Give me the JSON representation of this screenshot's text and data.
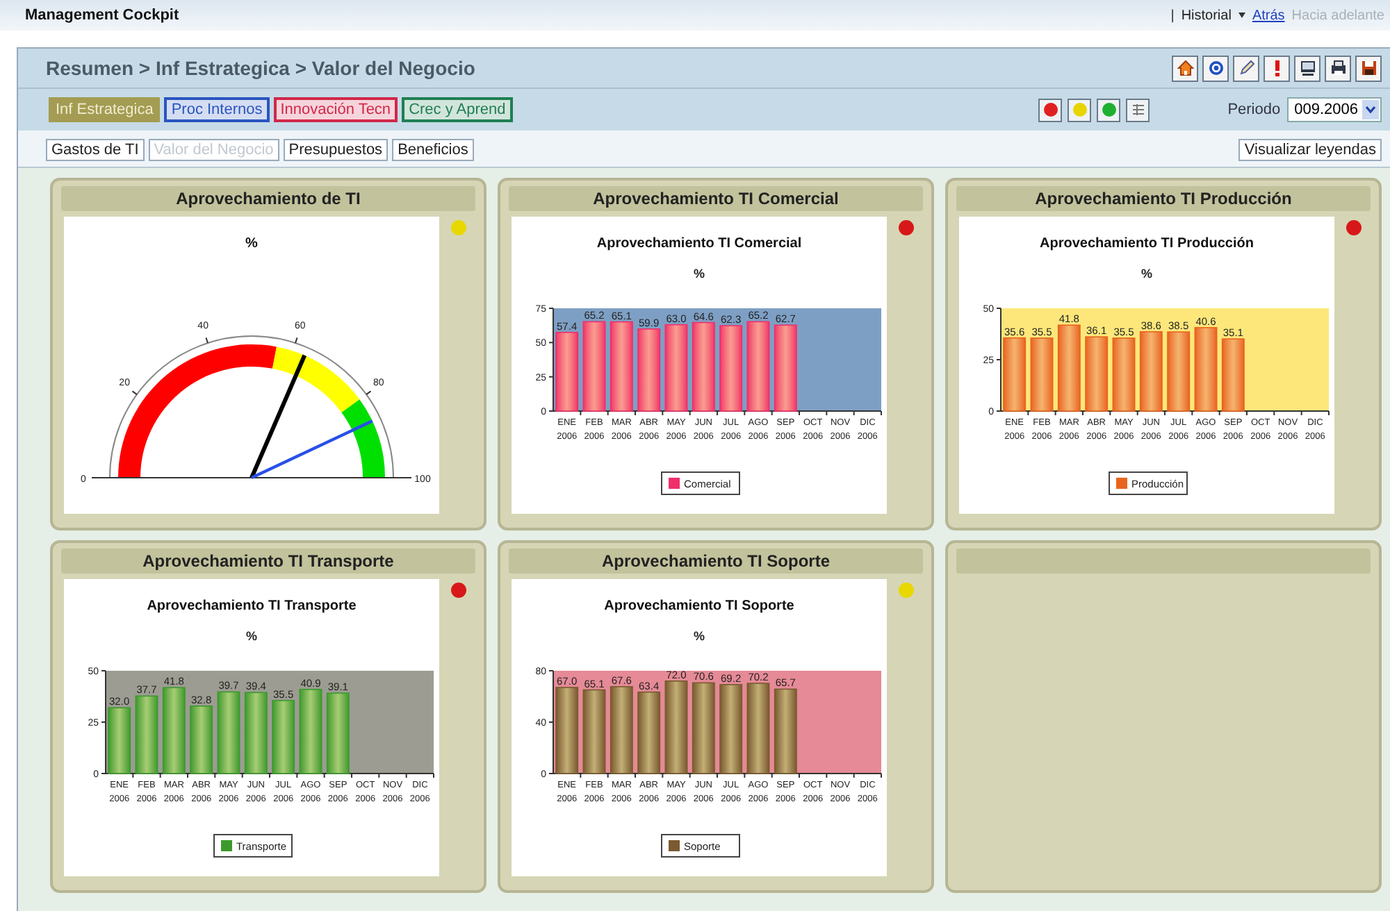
{
  "top_bar": {
    "title": "Management Cockpit",
    "separator": "|",
    "links": [
      {
        "label": "Historial",
        "kind": "menu"
      },
      {
        "label": "Atrás",
        "kind": "link"
      },
      {
        "label": "Hacia adelante",
        "kind": "disabled"
      }
    ]
  },
  "header": {
    "breadcrumb": "Resumen > Inf Estrategica > Valor del Negocio"
  },
  "tabs": [
    {
      "label": "Inf Estrategica",
      "selected": true,
      "color": "#a39c52"
    },
    {
      "label": "Proc Internos",
      "selected": false,
      "color": "#2a55c0"
    },
    {
      "label": "Innovación Tecn",
      "selected": false,
      "color": "#d0284a"
    },
    {
      "label": "Crec y Aprend",
      "selected": false,
      "color": "#1f7f52"
    }
  ],
  "status_filters": [
    {
      "color": "#e02020"
    },
    {
      "color": "#e8d400"
    },
    {
      "color": "#20b030"
    }
  ],
  "period": {
    "label": "Periodo",
    "value": "009.2006"
  },
  "subtabs": [
    {
      "label": "Gastos de TI",
      "selected": false
    },
    {
      "label": "Valor del Negocio",
      "selected": true
    },
    {
      "label": "Presupuestos",
      "selected": false
    },
    {
      "label": "Beneficios",
      "selected": false
    }
  ],
  "legend_button": "Visualizar leyendas",
  "panels": [
    {
      "kind": "gauge",
      "title": "Aprovechamiento de TI",
      "color": "#e8d800",
      "gauge": {
        "title": "%",
        "ticks": [
          "0",
          "20",
          "40",
          "60",
          "80",
          "100"
        ],
        "bands": [
          {
            "color": "#ff0000"
          },
          {
            "color": "#ffff00"
          },
          {
            "color": "#00e000"
          }
        ],
        "needles": [
          {
            "kind": "value"
          },
          {
            "kind": "target"
          }
        ]
      }
    },
    {
      "kind": "bars",
      "title": "Aprovechamiento TI Comercial",
      "color": "#d81818",
      "plot": {
        "color": "#7e9fc4"
      },
      "chart_data": {
        "type": "bar",
        "title": "Aprovechamiento TI Comercial",
        "ylabel": "%",
        "categories": [
          "ENE 2006",
          "FEB 2006",
          "MAR 2006",
          "ABR 2006",
          "MAY 2006",
          "JUN 2006",
          "JUL 2006",
          "AGO 2006",
          "SEP 2006",
          "OCT 2006",
          "NOV 2006",
          "DIC 2006"
        ],
        "series": [
          {
            "name": "Comercial",
            "color": "#f0306a",
            "values": [
              57.4,
              65.2,
              65.1,
              59.9,
              63.0,
              64.6,
              62.3,
              65.2,
              62.7,
              null,
              null,
              null
            ]
          }
        ],
        "ylim": [
          0,
          75
        ],
        "yticks": [
          0,
          25,
          50,
          75
        ],
        "value_labels": [
          "57.4",
          "65.2",
          "65.1",
          "59.9",
          "63.0",
          "64.6",
          "62.3",
          "65.2",
          "62.7",
          null,
          null,
          null
        ]
      }
    },
    {
      "kind": "bars",
      "title": "Aprovechamiento TI Producción",
      "color": "#d81818",
      "plot": {
        "color": "#fde77a"
      },
      "chart_data": {
        "type": "bar",
        "title": "Aprovechamiento TI Producción",
        "ylabel": "%",
        "categories": [
          "ENE 2006",
          "FEB 2006",
          "MAR 2006",
          "ABR 2006",
          "MAY 2006",
          "JUN 2006",
          "JUL 2006",
          "AGO 2006",
          "SEP 2006",
          "OCT 2006",
          "NOV 2006",
          "DIC 2006"
        ],
        "series": [
          {
            "name": "Producción",
            "color": "#e8641e",
            "values": [
              35.6,
              35.5,
              41.8,
              36.1,
              35.5,
              38.6,
              38.5,
              40.6,
              35.1,
              null,
              null,
              null
            ]
          }
        ],
        "ylim": [
          0,
          50
        ],
        "yticks": [
          0,
          25,
          50
        ],
        "value_labels": [
          "35.6",
          "35.5",
          "41.8",
          "36.1",
          "35.5",
          "38.6",
          "38.5",
          "40.6",
          "35.1",
          null,
          null,
          null
        ]
      }
    },
    {
      "kind": "bars",
      "title": "Aprovechamiento TI Transporte",
      "color": "#d81818",
      "plot": {
        "color": "#9c9c92"
      },
      "chart_data": {
        "type": "bar",
        "title": "Aprovechamiento TI Transporte",
        "ylabel": "%",
        "categories": [
          "ENE 2006",
          "FEB 2006",
          "MAR 2006",
          "ABR 2006",
          "MAY 2006",
          "JUN 2006",
          "JUL 2006",
          "AGO 2006",
          "SEP 2006",
          "OCT 2006",
          "NOV 2006",
          "DIC 2006"
        ],
        "series": [
          {
            "name": "Transporte",
            "color": "#3c9a2c",
            "values": [
              32.0,
              37.7,
              41.8,
              32.8,
              39.7,
              39.4,
              35.5,
              40.9,
              39.1,
              null,
              null,
              null
            ]
          }
        ],
        "ylim": [
          0,
          50
        ],
        "yticks": [
          0,
          25,
          50
        ],
        "value_labels": [
          "32.0",
          "37.7",
          "41.8",
          "32.8",
          "39.7",
          "39.4",
          "35.5",
          "40.9",
          "39.1",
          null,
          null,
          null
        ]
      }
    },
    {
      "kind": "bars",
      "title": "Aprovechamiento TI Soporte",
      "color": "#e8d800",
      "plot": {
        "color": "#e58a96"
      },
      "chart_data": {
        "type": "bar",
        "title": "Aprovechamiento TI Soporte",
        "ylabel": "%",
        "categories": [
          "ENE 2006",
          "FEB 2006",
          "MAR 2006",
          "ABR 2006",
          "MAY 2006",
          "JUN 2006",
          "JUL 2006",
          "AGO 2006",
          "SEP 2006",
          "OCT 2006",
          "NOV 2006",
          "DIC 2006"
        ],
        "series": [
          {
            "name": "Soporte",
            "color": "#7a5a30",
            "values": [
              67.0,
              65.1,
              67.6,
              63.4,
              72.0,
              70.6,
              69.2,
              70.2,
              65.7,
              null,
              null,
              null
            ]
          }
        ],
        "ylim": [
          0,
          80
        ],
        "yticks": [
          0,
          40,
          80
        ],
        "value_labels": [
          "67.0",
          "65.1",
          "67.6",
          "63.4",
          "72.0",
          "70.6",
          "69.2",
          "70.2",
          "65.7",
          null,
          null,
          null
        ]
      }
    },
    {
      "kind": "empty"
    }
  ]
}
